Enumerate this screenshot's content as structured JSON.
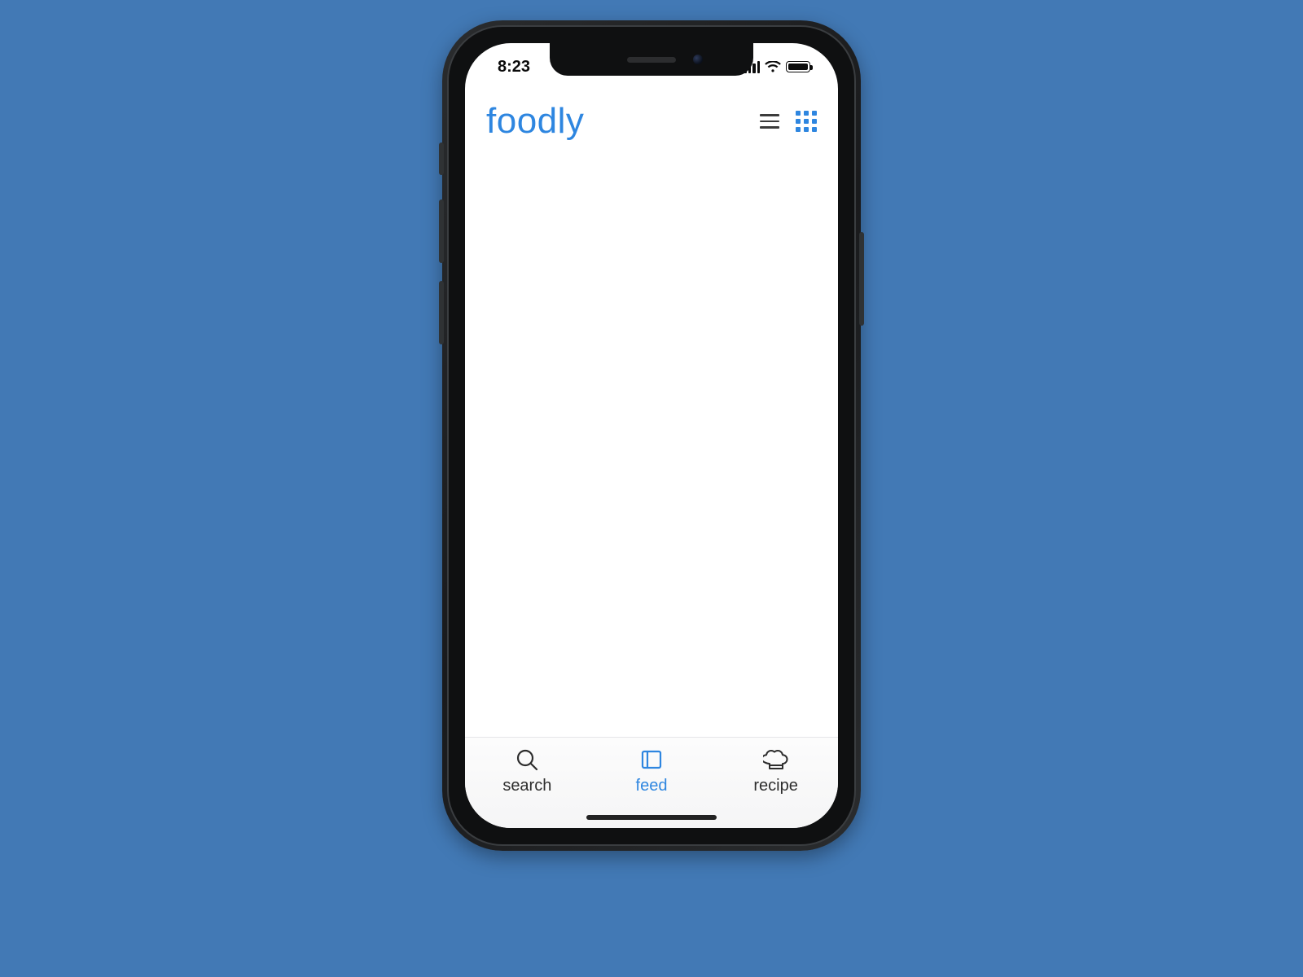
{
  "statusbar": {
    "time": "8:23"
  },
  "header": {
    "brand": "foodly"
  },
  "tabs": [
    {
      "id": "search",
      "label": "search",
      "active": false
    },
    {
      "id": "feed",
      "label": "feed",
      "active": true
    },
    {
      "id": "recipe",
      "label": "recipe",
      "active": false
    }
  ],
  "colors": {
    "accent": "#2e86e0",
    "background": "#4279b5"
  }
}
